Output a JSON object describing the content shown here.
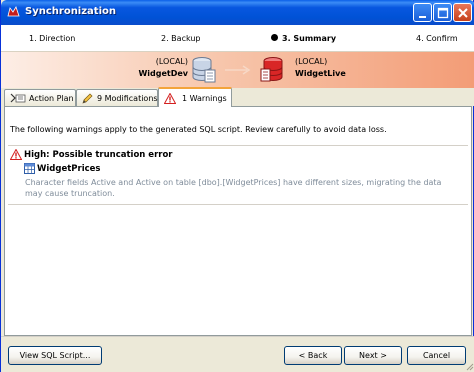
{
  "window": {
    "title": "Synchronization",
    "controls": [
      "minimize",
      "maximize",
      "close"
    ]
  },
  "steps": [
    {
      "label": "1. Direction",
      "active": false
    },
    {
      "label": "2. Backup",
      "active": false
    },
    {
      "label": "3. Summary",
      "active": true
    },
    {
      "label": "4. Confirm",
      "active": false
    }
  ],
  "banner": {
    "source": {
      "server": "(LOCAL)",
      "database": "WidgetDev",
      "icon": "database-blue-icon"
    },
    "target": {
      "server": "(LOCAL)",
      "database": "WidgetLive",
      "icon": "database-red-icon"
    }
  },
  "tabs": [
    {
      "label": "Action Plan",
      "icon": "action-plan-icon",
      "selected": false
    },
    {
      "label": "9 Modifications",
      "icon": "pencil-icon",
      "selected": false
    },
    {
      "label": "1 Warnings",
      "icon": "warning-icon",
      "selected": true
    }
  ],
  "warnings_panel": {
    "intro": "The following warnings apply to the generated SQL script. Review carefully to avoid data loss.",
    "warnings": [
      {
        "severity_title": "High: Possible truncation error",
        "object": "WidgetPrices",
        "detail": "Character fields Active and Active on table [dbo].[WidgetPrices] have different sizes, migrating the data may cause truncation."
      }
    ]
  },
  "footer": {
    "view_sql": "View SQL Script...",
    "back": "< Back",
    "next": "Next >",
    "cancel": "Cancel"
  },
  "colors": {
    "titlebar": "#0052d6",
    "banner_start": "#fdeee6",
    "banner_end": "#f39c76",
    "warning_red": "#d42020",
    "detail_text": "#7f8c9a"
  }
}
